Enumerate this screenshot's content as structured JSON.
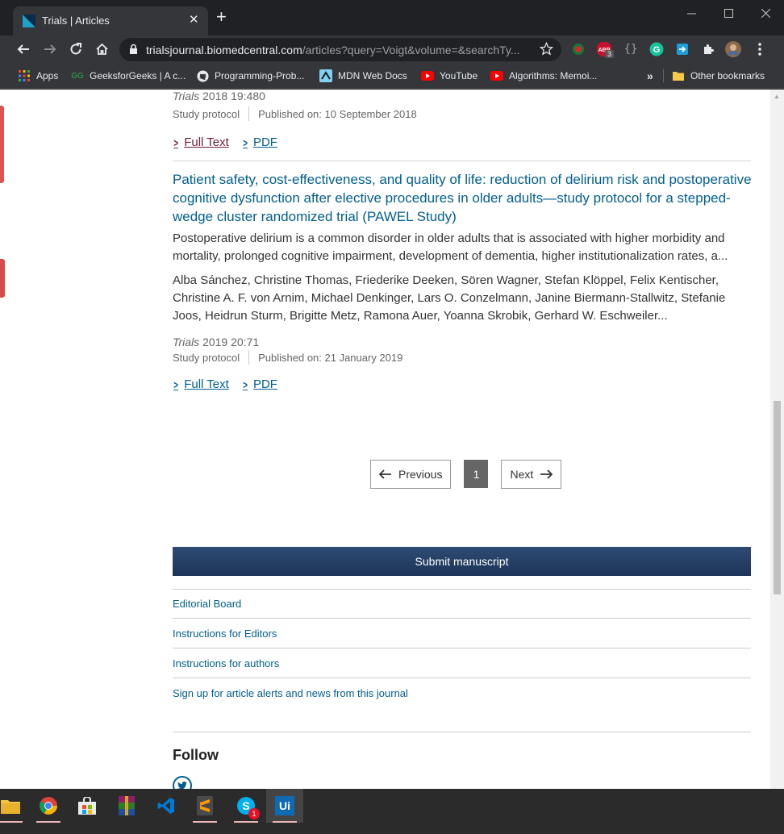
{
  "browser": {
    "tab_title": "Trials | Articles",
    "close_glyph": "✕",
    "new_tab_glyph": "+",
    "url_host": "trialsjournal.biomedcentral.com",
    "url_path": "/articles?query=Voigt&volume=&searchTy...",
    "ext_badge": "3"
  },
  "bookmarks": {
    "items": [
      "Apps",
      "GeeksforGeeks | A c...",
      "Programming-Prob...",
      "MDN Web Docs",
      "YouTube",
      "Algorithms: Memoi..."
    ],
    "more": "»",
    "other": "Other bookmarks"
  },
  "article_prev": {
    "journal": "Trials",
    "ref": "2018 19:480",
    "type": "Study protocol",
    "published": "Published on: 10 September 2018",
    "full_text": "Full Text",
    "pdf": "PDF"
  },
  "article": {
    "title": "Patient safety, cost-effectiveness, and quality of life: reduction of delirium risk and postoperative cognitive dysfunction after elective procedures in older adults—study protocol for a stepped-wedge cluster randomized trial (PAWEL Study)",
    "snippet": "Postoperative delirium is a common disorder in older adults that is associated with higher morbidity and mortality, prolonged cognitive impairment, development of dementia, higher institutionalization rates, a...",
    "authors": "Alba Sánchez, Christine Thomas, Friederike Deeken, Sören Wagner, Stefan Klöppel, Felix Kentischer, Christine A. F. von Arnim, Michael Denkinger, Lars O. Conzelmann, Janine Biermann-Stallwitz, Stefanie Joos, Heidrun Sturm, Brigitte Metz, Ramona Auer, Yoanna Skrobik, Gerhard W. Eschweiler...",
    "journal": "Trials",
    "ref": "2019 20:71",
    "type": "Study protocol",
    "published": "Published on: 21 January 2019",
    "full_text": "Full Text",
    "pdf": "PDF"
  },
  "pagination": {
    "previous": "Previous",
    "current": "1",
    "next": "Next"
  },
  "sidebar": {
    "submit": "Submit manuscript",
    "links": [
      "Editorial Board",
      "Instructions for Editors",
      "Instructions for authors",
      "Sign up for article alerts and news from this journal"
    ],
    "follow": "Follow"
  },
  "taskbar": {
    "skype_badge": "1",
    "uipath_label": "Ui"
  },
  "colors": {
    "link": "#025e8d",
    "visited": "#6b1f3a",
    "submit_bg": "#1c3458",
    "chrome_bg": "#35363a"
  }
}
